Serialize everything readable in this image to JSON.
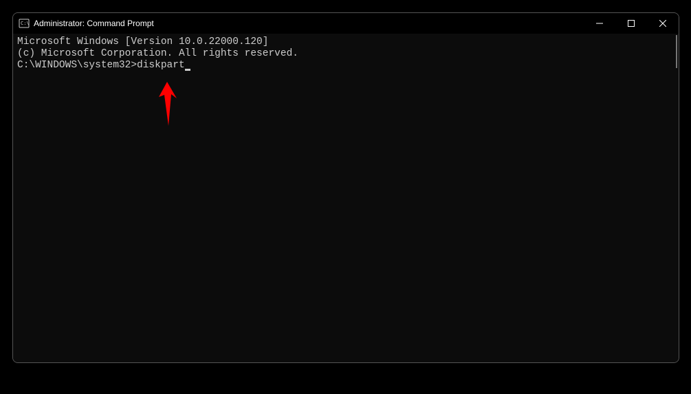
{
  "window": {
    "title": "Administrator: Command Prompt"
  },
  "terminal": {
    "line1": "Microsoft Windows [Version 10.0.22000.120]",
    "line2": "(c) Microsoft Corporation. All rights reserved.",
    "blank": "",
    "prompt": "C:\\WINDOWS\\system32>",
    "command": "diskpart"
  }
}
